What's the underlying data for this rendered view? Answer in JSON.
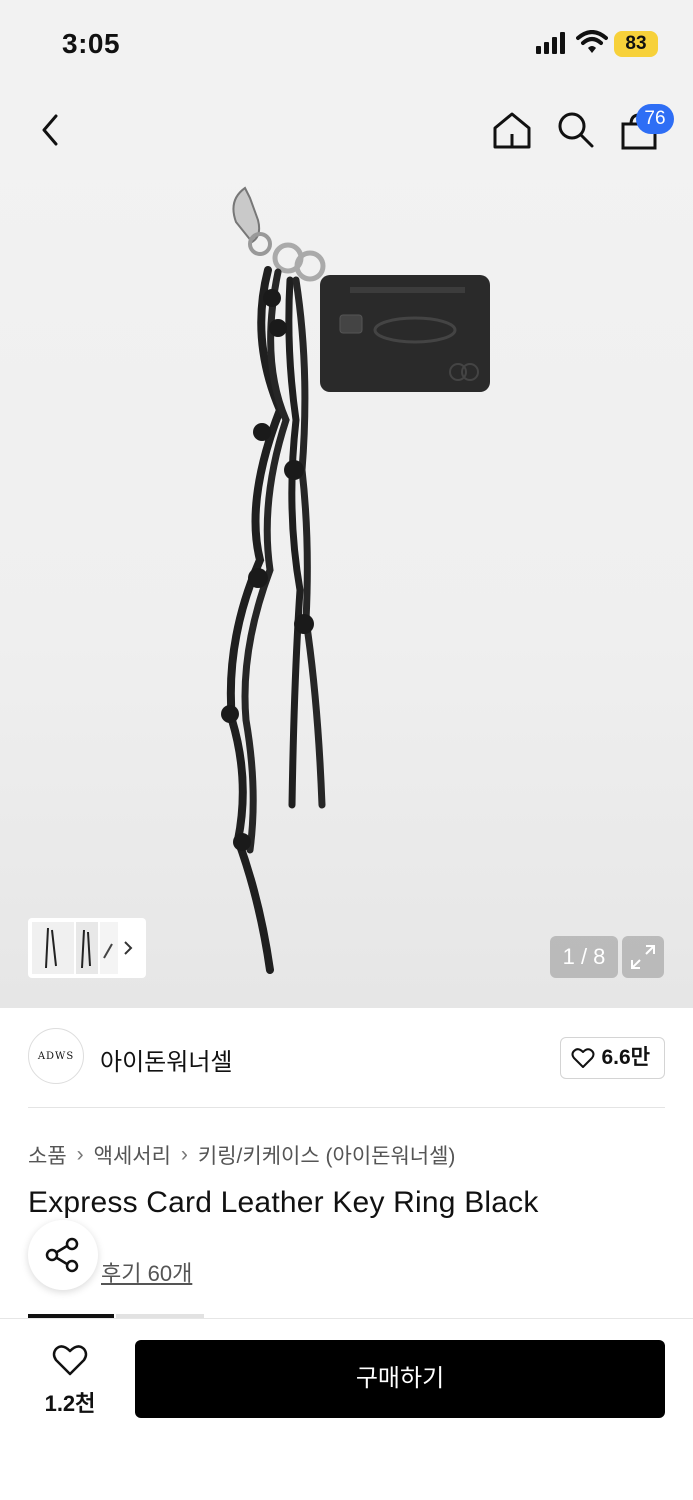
{
  "status": {
    "time": "3:05",
    "battery": "83"
  },
  "nav": {
    "cart_count": "76"
  },
  "gallery": {
    "counter": "1 / 8"
  },
  "brand": {
    "logo_text": "ADWS",
    "name": "아이돈워너셀",
    "likes": "6.6만"
  },
  "breadcrumb": [
    "소품",
    "액세서리",
    "키링/키케이스 (아이돈워너셀)"
  ],
  "product": {
    "title": "Express Card Leather Key Ring Black",
    "reviews": "후기 60개"
  },
  "bottom": {
    "like_count": "1.2천",
    "buy_label": "구매하기"
  },
  "icons": [
    "back-icon",
    "home-icon",
    "search-icon",
    "bag-icon",
    "expand-icon",
    "heart-icon",
    "share-icon",
    "chevron-right-icon"
  ]
}
